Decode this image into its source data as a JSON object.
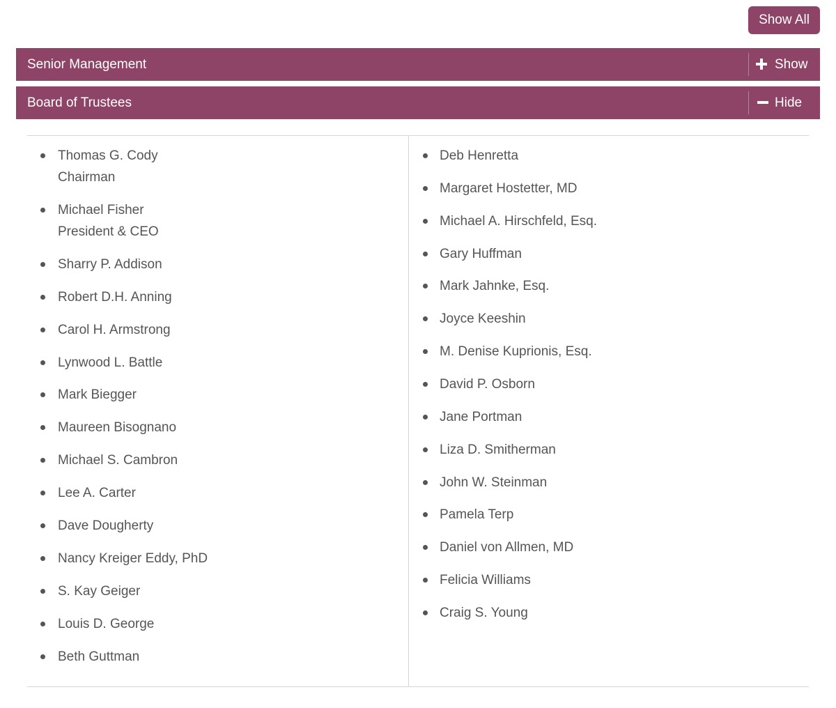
{
  "toolbar": {
    "show_all_label": "Show All"
  },
  "sections": {
    "senior": {
      "title": "Senior Management",
      "toggle_label": "Show"
    },
    "board": {
      "title": "Board of Trustees",
      "toggle_label": "Hide"
    }
  },
  "board_members": {
    "left": [
      {
        "name": "Thomas G. Cody",
        "role": "Chairman"
      },
      {
        "name": "Michael Fisher",
        "role": "President & CEO"
      },
      {
        "name": "Sharry P. Addison"
      },
      {
        "name": "Robert D.H. Anning"
      },
      {
        "name": "Carol H. Armstrong"
      },
      {
        "name": "Lynwood L. Battle"
      },
      {
        "name": "Mark Biegger"
      },
      {
        "name": "Maureen Bisognano"
      },
      {
        "name": "Michael S. Cambron"
      },
      {
        "name": "Lee A. Carter"
      },
      {
        "name": "Dave Dougherty"
      },
      {
        "name": "Nancy Kreiger Eddy, PhD"
      },
      {
        "name": "S. Kay Geiger"
      },
      {
        "name": "Louis D. George"
      },
      {
        "name": "Beth Guttman"
      }
    ],
    "right": [
      {
        "name": "Deb Henretta"
      },
      {
        "name": "Margaret Hostetter, MD"
      },
      {
        "name": "Michael A. Hirschfeld, Esq."
      },
      {
        "name": "Gary Huffman"
      },
      {
        "name": "Mark Jahnke, Esq."
      },
      {
        "name": "Joyce Keeshin"
      },
      {
        "name": "M. Denise Kuprionis, Esq."
      },
      {
        "name": "David P. Osborn"
      },
      {
        "name": "Jane Portman"
      },
      {
        "name": "Liza D. Smitherman"
      },
      {
        "name": "John W. Steinman"
      },
      {
        "name": "Pamela Terp"
      },
      {
        "name": "Daniel von Allmen, MD"
      },
      {
        "name": "Felicia Williams"
      },
      {
        "name": "Craig S. Young"
      }
    ]
  }
}
